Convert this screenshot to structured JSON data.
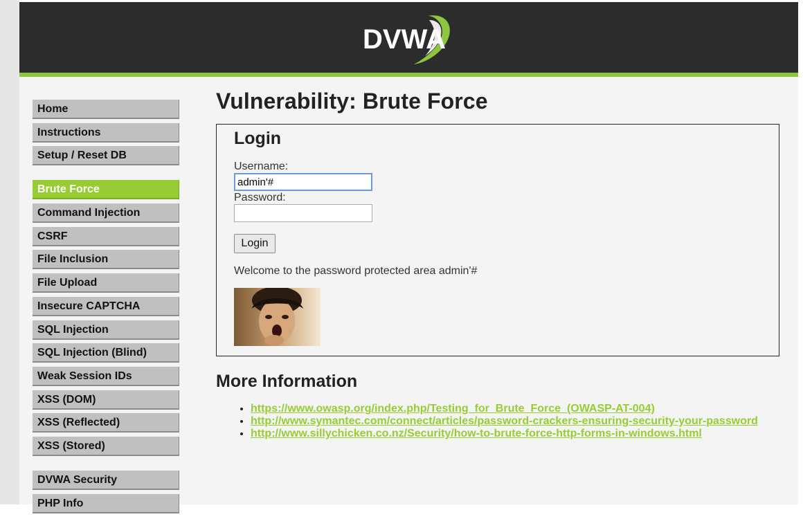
{
  "header": {
    "logo_text": "DVWA",
    "accent_color": "#8dc63f"
  },
  "menu": {
    "groups": [
      [
        {
          "label": "Home"
        },
        {
          "label": "Instructions"
        },
        {
          "label": "Setup / Reset DB"
        }
      ],
      [
        {
          "label": "Brute Force",
          "active": true
        },
        {
          "label": "Command Injection"
        },
        {
          "label": "CSRF"
        },
        {
          "label": "File Inclusion"
        },
        {
          "label": "File Upload"
        },
        {
          "label": "Insecure CAPTCHA"
        },
        {
          "label": "SQL Injection"
        },
        {
          "label": "SQL Injection (Blind)"
        },
        {
          "label": "Weak Session IDs"
        },
        {
          "label": "XSS (DOM)"
        },
        {
          "label": "XSS (Reflected)"
        },
        {
          "label": "XSS (Stored)"
        }
      ],
      [
        {
          "label": "DVWA Security"
        },
        {
          "label": "PHP Info"
        }
      ]
    ]
  },
  "main": {
    "title": "Vulnerability: Brute Force",
    "login": {
      "heading": "Login",
      "username_label": "Username:",
      "username_value": "admin'#",
      "password_label": "Password:",
      "password_value": "",
      "button_label": "Login",
      "welcome": "Welcome to the password protected area admin'#"
    },
    "more_info": {
      "heading": "More Information",
      "links": [
        "https://www.owasp.org/index.php/Testing_for_Brute_Force_(OWASP-AT-004)",
        "http://www.symantec.com/connect/articles/password-crackers-ensuring-security-your-password",
        "http://www.sillychicken.co.nz/Security/how-to-brute-force-http-forms-in-windows.html"
      ]
    }
  }
}
